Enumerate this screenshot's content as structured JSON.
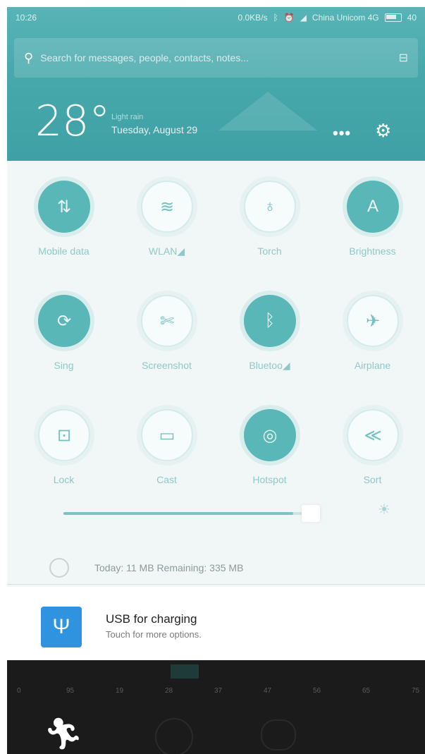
{
  "status_bar": {
    "time": "10:26",
    "speed": "0.0KB/s",
    "carrier": "China Unicom 4G",
    "battery": "40"
  },
  "search": {
    "placeholder": "Search for messages, people, contacts, notes..."
  },
  "weather": {
    "temperature": "28°",
    "location": "Light rain",
    "date": "Tuesday, August 29"
  },
  "toggles": [
    {
      "label": "Mobile data",
      "icon": "mobile-data-icon",
      "glyph": "⇅",
      "on": true
    },
    {
      "label": "WLAN◢",
      "icon": "wifi-icon",
      "glyph": "≋",
      "on": false
    },
    {
      "label": "Torch",
      "icon": "torch-icon",
      "glyph": "♁",
      "on": false
    },
    {
      "label": "Brightness",
      "icon": "brightness-icon",
      "glyph": "A",
      "on": true
    },
    {
      "label": "Sing",
      "icon": "sync-icon",
      "glyph": "⟳",
      "on": true
    },
    {
      "label": "Screenshot",
      "icon": "screenshot-icon",
      "glyph": "✄",
      "on": false
    },
    {
      "label": "Bluetoo◢",
      "icon": "bluetooth-icon",
      "glyph": "ᛒ",
      "on": true
    },
    {
      "label": "Airplane",
      "icon": "airplane-icon",
      "glyph": "✈",
      "on": false
    },
    {
      "label": "Lock",
      "icon": "lock-icon",
      "glyph": "⊡",
      "on": false
    },
    {
      "label": "Cast",
      "icon": "cast-icon",
      "glyph": "▭",
      "on": false
    },
    {
      "label": "Hotspot",
      "icon": "hotspot-icon",
      "glyph": "◎",
      "on": true
    },
    {
      "label": "Sort",
      "icon": "sort-icon",
      "glyph": "≪",
      "on": false
    }
  ],
  "brightness": {
    "level": 0.93,
    "auto_icon": "auto-brightness-icon"
  },
  "data_usage": {
    "text": "Today: 11 MB  Remaining: 335 MB"
  },
  "notification": {
    "title": "USB for charging",
    "subtitle": "Touch for more options.",
    "icon": "usb-icon"
  },
  "bottom_app": {
    "ticks": [
      "0",
      "95",
      "19",
      "28",
      "37",
      "47",
      "56",
      "65",
      "75"
    ],
    "run_icon": "running-man-icon"
  },
  "colors": {
    "header": "#48a9ac",
    "toggle_on": "#59b7b7",
    "usb": "#2f93e0"
  }
}
